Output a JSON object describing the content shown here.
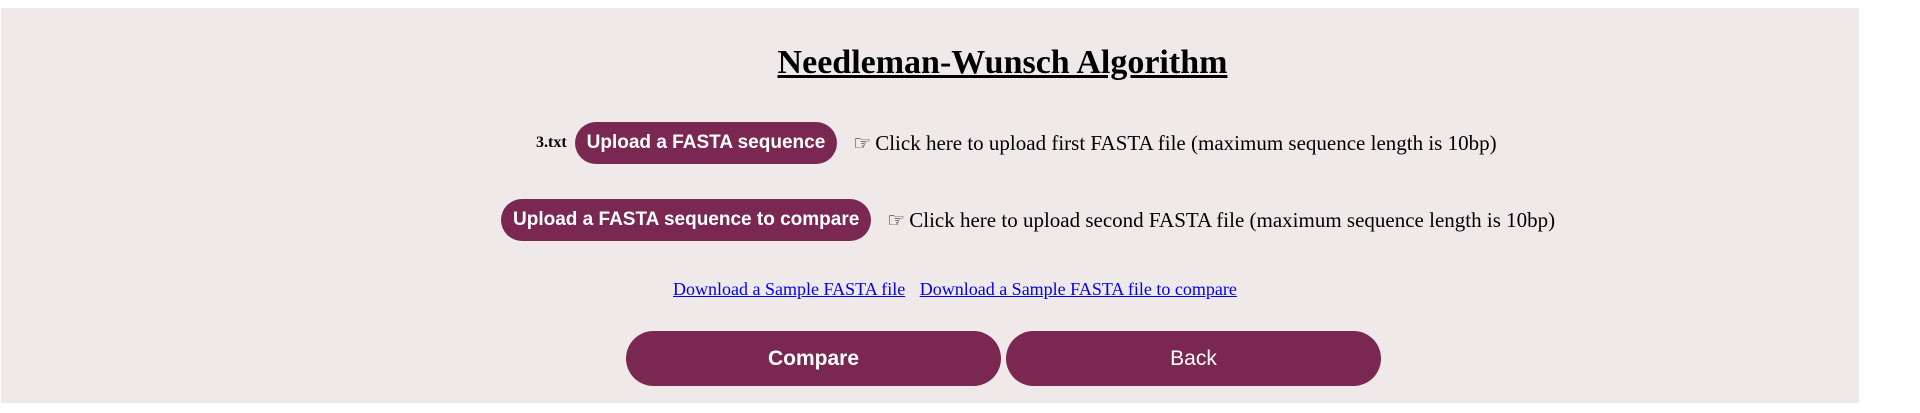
{
  "header": {
    "title": "Needleman-Wunsch Algorithm"
  },
  "upload_first": {
    "file_name": "3.txt",
    "button_label": "Upload a FASTA sequence",
    "hint": "Click here to upload first FASTA file (maximum sequence length is 10bp)"
  },
  "upload_second": {
    "button_label": "Upload a FASTA sequence to compare",
    "hint": "Click here to upload second FASTA file (maximum sequence length is 10bp)"
  },
  "links": {
    "sample_first": "Download a Sample FASTA file",
    "sample_second": "Download a Sample FASTA file to compare"
  },
  "actions": {
    "compare_label": "Compare",
    "back_label": "Back"
  },
  "icons": {
    "pointer": "pointing-hand-icon"
  },
  "colors": {
    "accent": "#7a2751",
    "panel_background": "#efe9ea",
    "link": "#0000ee"
  }
}
